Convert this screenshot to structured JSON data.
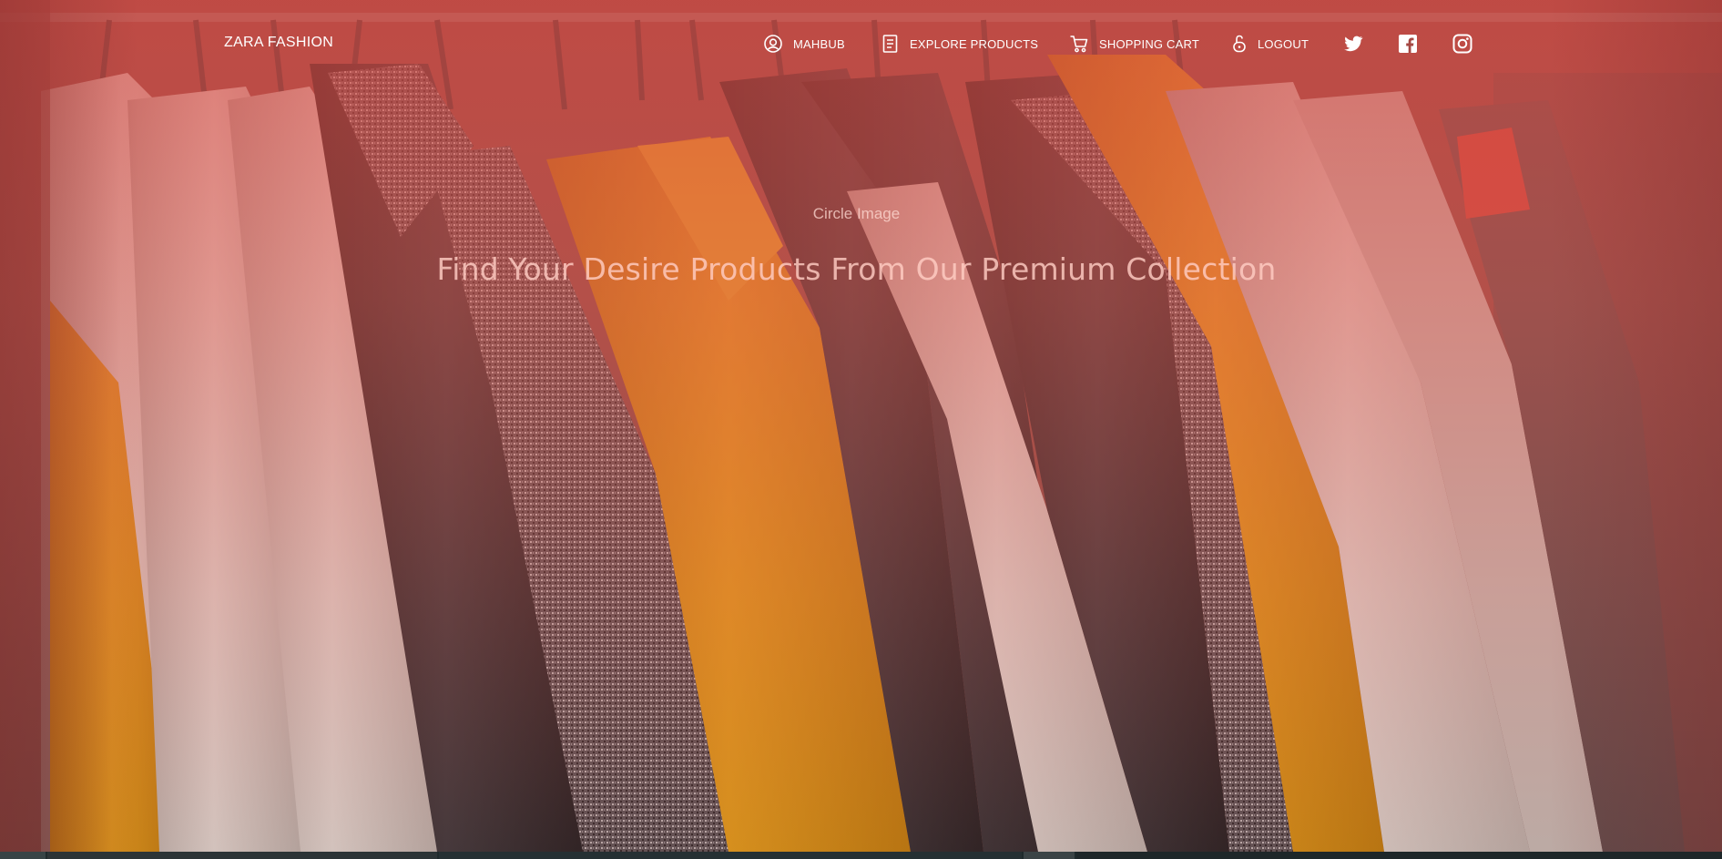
{
  "navbar": {
    "brand": "ZARA FASHION",
    "items": [
      {
        "label": "MAHBUB",
        "icon": "user-circle-icon"
      },
      {
        "label": "EXPLORE PRODUCTS",
        "icon": "document-list-icon"
      },
      {
        "label": "SHOPPING CART",
        "icon": "shopping-cart-icon"
      },
      {
        "label": "LOGOUT",
        "icon": "unlock-icon"
      }
    ],
    "social": [
      "twitter-icon",
      "facebook-icon",
      "instagram-icon"
    ]
  },
  "hero": {
    "image_alt": "Circle Image",
    "headline": "Find Your Desire Products From Our Premium Collection"
  },
  "colors": {
    "overlay": "#d64a44",
    "text": "#ffffff",
    "coat_yellow": "#e39a10",
    "coat_dark": "#2b2b2e",
    "coat_white": "#e4e0d9",
    "coat_tweed": "#6b6466"
  }
}
